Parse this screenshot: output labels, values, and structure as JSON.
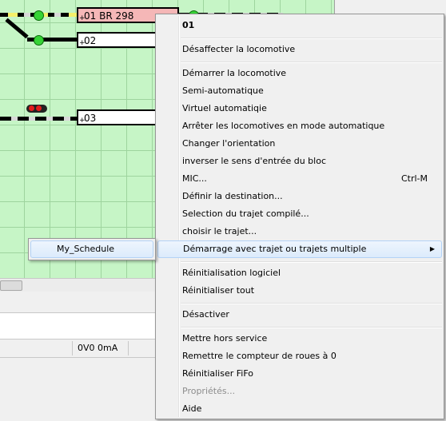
{
  "track": {
    "blocks": [
      {
        "label": "01 BR 298",
        "plus": "+"
      },
      {
        "label": "02",
        "plus": "+"
      },
      {
        "label": "03",
        "plus": "+"
      }
    ]
  },
  "status": {
    "power": "0V0 0mA"
  },
  "context_menu": {
    "title": "01",
    "items": [
      {
        "label": "Désaffecter la locomotive"
      },
      {
        "label": "Démarrer la locomotive"
      },
      {
        "label": "Semi-automatique"
      },
      {
        "label": "Virtuel automatiqie"
      },
      {
        "label": "Arrêter les locomotives en mode automatique"
      },
      {
        "label": "Changer l'orientation"
      },
      {
        "label": "inverser le sens d'entrée du bloc"
      },
      {
        "label": "MIC...",
        "shortcut": "Ctrl-M"
      },
      {
        "label": "Définir la destination..."
      },
      {
        "label": "Selection du trajet compilé..."
      },
      {
        "label": "choisir le trajet..."
      },
      {
        "label": "Démarrage avec trajet ou trajets multiple"
      },
      {
        "label": "Réinitialisation logiciel"
      },
      {
        "label": "Réinitialiser tout"
      },
      {
        "label": "Désactiver"
      },
      {
        "label": "Mettre hors service"
      },
      {
        "label": "Remettre le compteur de roues à 0"
      },
      {
        "label": "Réinitialiser FiFo"
      },
      {
        "label": "Propriétés..."
      },
      {
        "label": "Aide"
      }
    ]
  },
  "submenu": {
    "items": [
      {
        "label": "My_Schedule"
      }
    ]
  },
  "colors": {
    "grid_bg": "#c6f5c6",
    "occupied_block": "#f5b7b7",
    "highlight": "#dcebfc"
  }
}
